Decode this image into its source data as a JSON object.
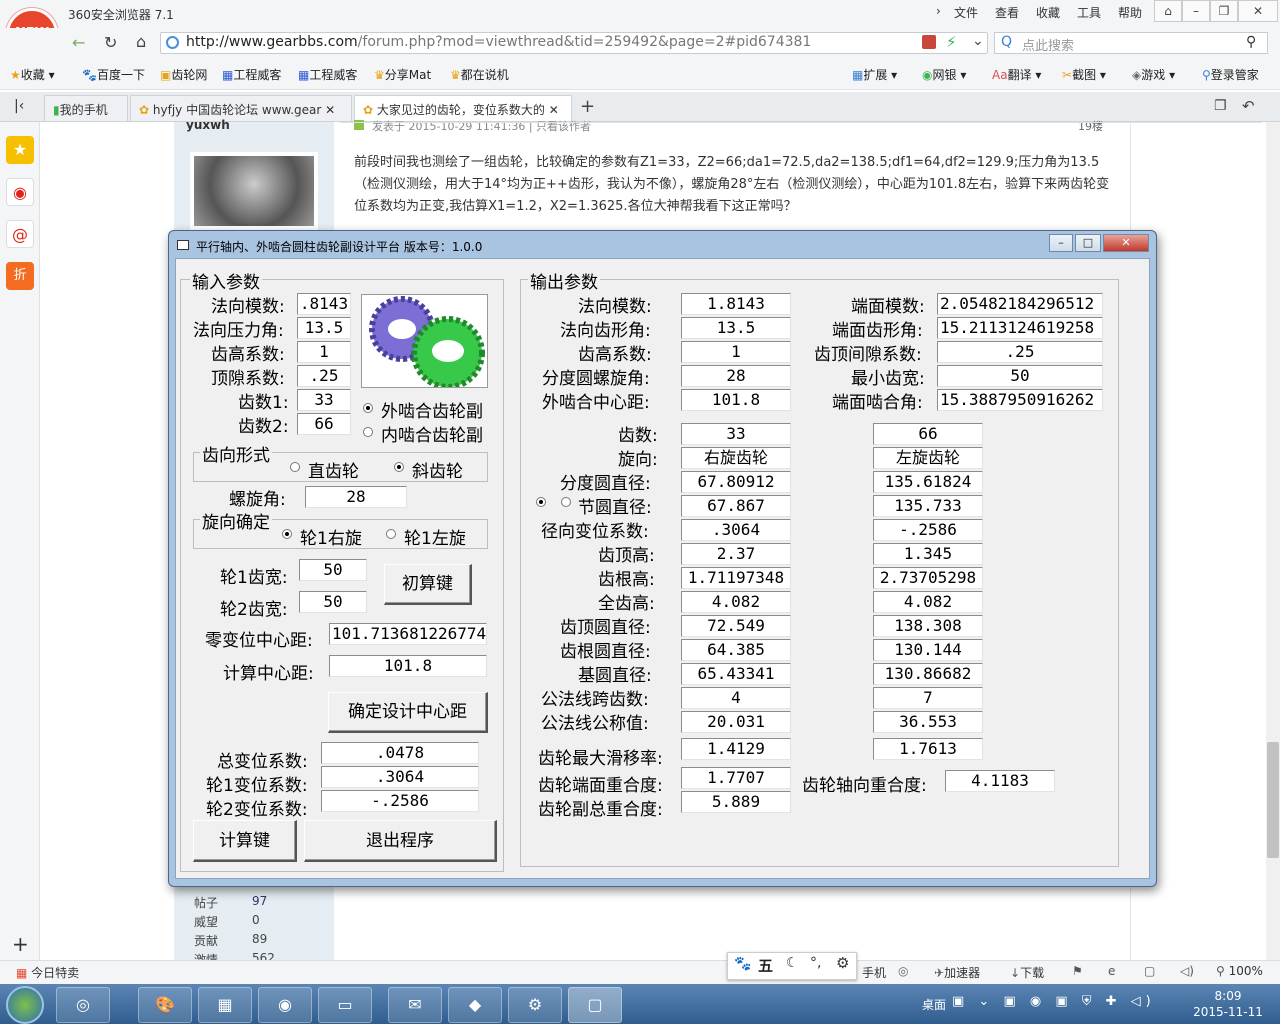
{
  "browser": {
    "logo_text": "NEW",
    "title": "360安全浏览器 7.1",
    "menu": [
      "文件",
      "查看",
      "收藏",
      "工具",
      "帮助"
    ],
    "url_host": "http://www.gearbbs.com",
    "url_rest": "/forum.php?mod=viewthread&tid=259492&page=2#pid674381",
    "search_placeholder": "点此搜索",
    "bookmarks": [
      "收藏",
      "百度一下",
      "齿轮网",
      "工程威客",
      "工程威客",
      "分享Mat",
      "都在说机"
    ],
    "toolbar_right": [
      "扩展",
      "网银",
      "翻译",
      "截图",
      "游戏",
      "登录管家"
    ],
    "tabs": [
      "我的手机",
      "hyfjy 中国齿轮论坛 www.gear",
      "大家见过的齿轮，变位系数大的"
    ],
    "status_left": "今日特卖",
    "status_right": [
      "手机",
      "加速器",
      "下载",
      "100%"
    ],
    "ime_char": "五",
    "taskbar_right": [
      "桌面"
    ],
    "clock_time": "8:09",
    "clock_date": "2015-11-11"
  },
  "post": {
    "author": "yuxwh",
    "meta": "发表于 2015-10-29 11:41:36  |  只看该作者",
    "floor": "19楼",
    "content": "前段时间我也测绘了一组齿轮，比较确定的参数有Z1=33，Z2=66;da1=72.5,da2=138.5;df1=64,df2=129.9;压力角为13.5（检测仪测绘，用大于14°均为正++齿形，我认为不像），螺旋角28°左右（检测仪测绘），中心距为101.8左右，验算下来两齿轮变位系数均为正变,我估算X1=1.2，X2=1.3625.各位大神帮我看下这正常吗？",
    "stats": [
      {
        "label": "帖子",
        "value": "97"
      },
      {
        "label": "威望",
        "value": "0"
      },
      {
        "label": "贡献",
        "value": "89"
      },
      {
        "label": "激情",
        "value": "562"
      }
    ]
  },
  "app": {
    "title": "平行轴内、外啮合圆柱齿轮副设计平台 版本号：1.0.0",
    "input_group": "输入参数",
    "output_group": "输出参数",
    "inputs": {
      "labels": [
        "法向模数:",
        "法向压力角:",
        "齿高系数:",
        "顶隙系数:",
        "齿数1:",
        "齿数2:"
      ],
      "values": [
        ".8143",
        "13.5",
        "1",
        ".25",
        "33",
        "66"
      ]
    },
    "mesh_options": [
      "外啮合齿轮副",
      "内啮合齿轮副"
    ],
    "tooth_form": {
      "title": "齿向形式",
      "options": [
        "直齿轮",
        "斜齿轮"
      ]
    },
    "helix_label": "螺旋角:",
    "helix_value": "28",
    "hand": {
      "title": "旋向确定",
      "options": [
        "轮1右旋",
        "轮1左旋"
      ]
    },
    "width1_label": "轮1齿宽:",
    "width1_value": "50",
    "width2_label": "轮2齿宽:",
    "width2_value": "50",
    "calc_init_btn": "初算键",
    "zero_center_label": "零变位中心距:",
    "zero_center_value": "101.713681226774",
    "calc_center_label": "计算中心距:",
    "calc_center_value": "101.8",
    "confirm_center_btn": "确定设计中心距",
    "shift_labels": [
      "总变位系数:",
      "轮1变位系数:",
      "轮2变位系数:"
    ],
    "shift_values": [
      ".0478",
      ".3064",
      "-.2586"
    ],
    "calc_btn": "计算键",
    "exit_btn": "退出程序",
    "out_left": {
      "labels": [
        "法向模数:",
        "法向齿形角:",
        "齿高系数:",
        "分度圆螺旋角:",
        "外啮合中心距:"
      ],
      "values": [
        "1.8143",
        "13.5",
        "1",
        "28",
        "101.8"
      ]
    },
    "out_right": {
      "labels": [
        "端面模数:",
        "端面齿形角:",
        "齿顶间隙系数:",
        "最小齿宽:",
        "端面啮合角:"
      ],
      "values": [
        "2.05482184296512",
        "15.2113124619258",
        ".25",
        "50",
        "15.3887950916262"
      ]
    },
    "gear_rows": {
      "labels": [
        "齿数:",
        "旋向:",
        "分度圆直径:",
        "节圆直径:",
        "径向变位系数:",
        "齿顶高:",
        "齿根高:",
        "全齿高:",
        "齿顶圆直径:",
        "齿根圆直径:",
        "基圆直径:",
        "公法线跨齿数:",
        "公法线公称值:"
      ],
      "gear1": [
        "33",
        "右旋齿轮",
        "67.80912",
        "67.867",
        ".3064",
        "2.37",
        "1.71197348",
        "4.082",
        "72.549",
        "64.385",
        "65.43341",
        "4",
        "20.031"
      ],
      "gear2": [
        "66",
        "左旋齿轮",
        "135.61824",
        "135.733",
        "-.2586",
        "1.345",
        "2.73705298",
        "4.082",
        "138.308",
        "130.144",
        "130.86682",
        "7",
        "36.553"
      ]
    },
    "slip_label": "齿轮最大滑移率:",
    "slip_values": [
      "1.4129",
      "1.7613"
    ],
    "transverse_label": "齿轮端面重合度:",
    "transverse_value": "1.7707",
    "axial_label": "齿轮轴向重合度:",
    "axial_value": "4.1183",
    "total_label": "齿轮副总重合度:",
    "total_value": "5.889"
  }
}
